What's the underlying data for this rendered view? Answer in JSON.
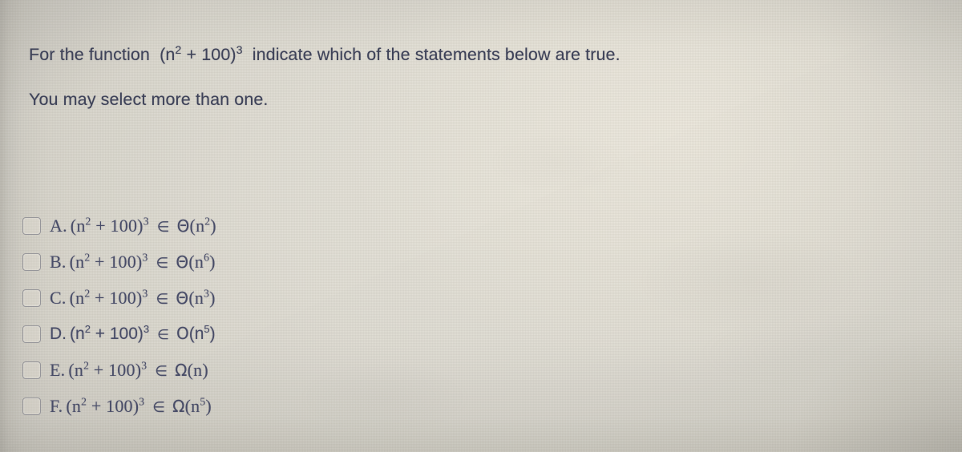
{
  "colors": {
    "paper": "#ded9cf",
    "question_text": "#3b3f56",
    "option_text": "#474b66",
    "checkbox_border": "#8e8e94"
  },
  "question": {
    "line1_prefix": "For the function",
    "function_base": "(n",
    "function_exp_inner": "2",
    "function_mid": " + 100)",
    "function_exp_outer": "3",
    "line1_suffix": "indicate which of the statements below are true.",
    "line2": "You may select more than one."
  },
  "options": [
    {
      "label": "A.",
      "expr_base": "(n",
      "expr_exp_inner": "2",
      "expr_mid": " + 100)",
      "expr_exp_outer": "3",
      "relation": "∈",
      "bound_symbol": "Θ",
      "bound_open": "(n",
      "bound_exp": "2",
      "bound_close": ")",
      "checked": false,
      "font": "serif"
    },
    {
      "label": "B.",
      "expr_base": "(n",
      "expr_exp_inner": "2",
      "expr_mid": " + 100)",
      "expr_exp_outer": "3",
      "relation": "∈",
      "bound_symbol": "Θ",
      "bound_open": "(n",
      "bound_exp": "6",
      "bound_close": ")",
      "checked": false,
      "font": "serif"
    },
    {
      "label": "C.",
      "expr_base": "(n",
      "expr_exp_inner": "2",
      "expr_mid": " + 100)",
      "expr_exp_outer": "3",
      "relation": "∈",
      "bound_symbol": "Θ",
      "bound_open": "(n",
      "bound_exp": "3",
      "bound_close": ")",
      "checked": false,
      "font": "serif"
    },
    {
      "label": "D.",
      "expr_base": "(n",
      "expr_exp_inner": "2",
      "expr_mid": " + 100)",
      "expr_exp_outer": "3",
      "relation": "∈",
      "bound_symbol": "O",
      "bound_open": "(n",
      "bound_exp": "5",
      "bound_close": ")",
      "checked": false,
      "font": "sans"
    },
    {
      "label": "E.",
      "expr_base": "(n",
      "expr_exp_inner": "2",
      "expr_mid": " + 100)",
      "expr_exp_outer": "3",
      "relation": "∈",
      "bound_symbol": "Ω",
      "bound_open": "(n",
      "bound_exp": "",
      "bound_close": ")",
      "checked": false,
      "font": "serif"
    },
    {
      "label": "F.",
      "expr_base": "(n",
      "expr_exp_inner": "2",
      "expr_mid": " + 100)",
      "expr_exp_outer": "3",
      "relation": "∈",
      "bound_symbol": "Ω",
      "bound_open": "(n",
      "bound_exp": "5",
      "bound_close": ")",
      "checked": false,
      "font": "serif"
    }
  ]
}
